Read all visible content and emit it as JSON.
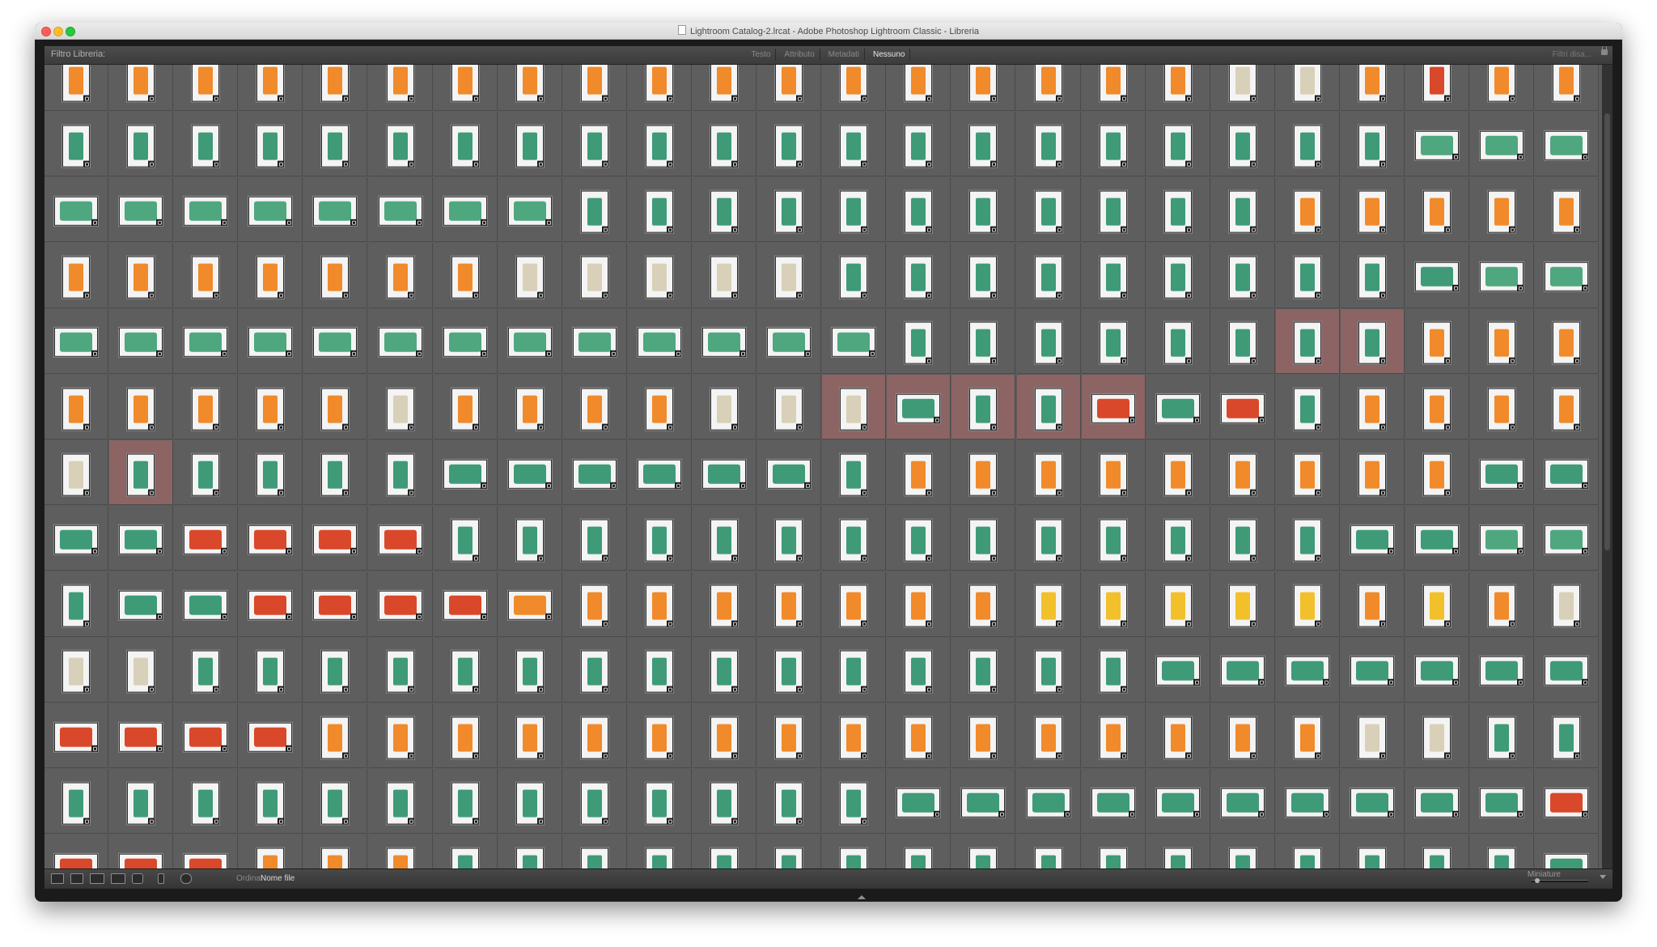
{
  "window": {
    "title": "Lightroom Catalog-2.lrcat - Adobe Photoshop Lightroom Classic - Libreria"
  },
  "filter_bar": {
    "label": "Filtro Libreria:",
    "tabs": [
      {
        "label": "Testo",
        "active": false
      },
      {
        "label": "Attributo",
        "active": false
      },
      {
        "label": "Metadati",
        "active": false
      },
      {
        "label": "Nessuno",
        "active": true
      }
    ],
    "preset": "Filtri disa..."
  },
  "toolbar": {
    "view_icons": [
      "grid-view-icon",
      "loupe-view-icon",
      "compare-view-icon",
      "survey-view-icon",
      "people-view-icon"
    ],
    "painter_icon": "painter-spray-can-icon",
    "sort_direction_icon": "sort-direction-icon",
    "sort_label": "Ordina:",
    "sort_value": "Nome file",
    "thumbnail_label": "Miniature",
    "thumbnail_size": 0.1
  },
  "grid": {
    "rows": 13,
    "columns": 24,
    "rows_codes": [
      "PPPPPPPPPPPPPPPPPPPPPPPP",
      "PPPPPPPPPPPPPPPPPPPPPLLL",
      "LLLLLLLLPPPPPPPPPPPPPPPP",
      "PPPPPPPPPPPPPPPPPPPPPLLL",
      "LLLLLLLLLLLLLPPPPPPPPPPP",
      "PPPPPPPPPPPPPLPPLLLPPPPP",
      "PPPPPPLLLLLLPPPPPPPPPPLL",
      "LLLLLLPPPPPPPPPPPPPPLLLL",
      "PLLLLLLLPPPPPPPPPPPPPPPP",
      "PPPPPPPPPPPPPPPPPLLLLLLL",
      "LLLLPPPPPPPPPPPPPPPPPPPP",
      "PPPPPPPPPPPPPLLLLLLLLLLL",
      "LLLPPPPPPPPPPPPPPPPPPPPL"
    ],
    "object_colors": {
      "g": "#3f9a78",
      "o": "#f08a2a",
      "r": "#d9482a",
      "y": "#f2c02b",
      "w": "#d8d0b8",
      "m": "#4fa77f"
    },
    "color_rows": [
      "oooooooooooooooooowworoo",
      "gggggggggggggggggggggmmm",
      "mmmmmmmmgggggggggggooooo",
      "ooooooowwwwwggggggggggmm",
      "mmmmmmmmmmmmmggggggggooo",
      "ooooowoooowwwgggrgrgoooo",
      "wggggggggggggooooooooogg",
      "ggrrrrggggggggggggggggmm",
      "gggrrrrooooooooyyyyyoyow",
      "wwggggggggggggggggggggg",
      "rrrroooooooooooooooowwgg",
      "gggggggggggggggggggggggr",
      "rrrooogggggggggggggggggg"
    ],
    "selected_cells": [
      [
        4,
        19
      ],
      [
        4,
        20
      ],
      [
        5,
        12
      ],
      [
        5,
        13
      ],
      [
        5,
        14
      ],
      [
        5,
        15
      ],
      [
        5,
        16
      ],
      [
        6,
        1
      ]
    ]
  }
}
